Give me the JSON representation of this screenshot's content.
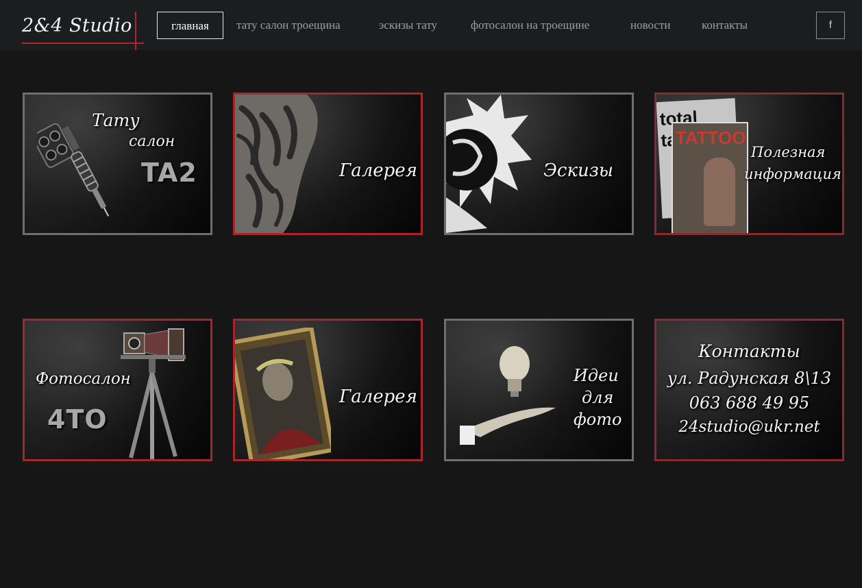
{
  "header": {
    "logo": "2&4 Studio",
    "nav": [
      {
        "label": "главная",
        "active": true
      },
      {
        "label": "тату салон троещина"
      },
      {
        "label": "эскизы тату"
      },
      {
        "label": "фотосалон на троещине"
      },
      {
        "label": "новости"
      },
      {
        "label": "контакты"
      }
    ],
    "social": {
      "label": "f",
      "icon": "facebook-icon"
    }
  },
  "tiles": {
    "tattoo_salon": {
      "line1": "Тату",
      "line2": "салон",
      "brand": "TA2"
    },
    "tattoo_gallery": {
      "label": "Галерея"
    },
    "sketches": {
      "label": "Эскизы"
    },
    "useful_info": {
      "line1": "Полезная",
      "line2": "информация",
      "magazine1": "total tattoo",
      "magazine2": "TATTOO"
    },
    "photo_salon": {
      "line1": "Фотосалон",
      "brand": "4TO"
    },
    "photo_gallery": {
      "label": "Галерея"
    },
    "photo_ideas": {
      "line1": "Идеи",
      "line2": "для",
      "line3": "фото"
    },
    "contacts": {
      "title": "Контакты",
      "address": "ул. Радунская 8\\13",
      "phone": "063 688 49 95",
      "email": "24studio@ukr.net"
    }
  },
  "colors": {
    "accent": "#b0262c",
    "background": "#161616",
    "header": "#1b1d1f"
  }
}
